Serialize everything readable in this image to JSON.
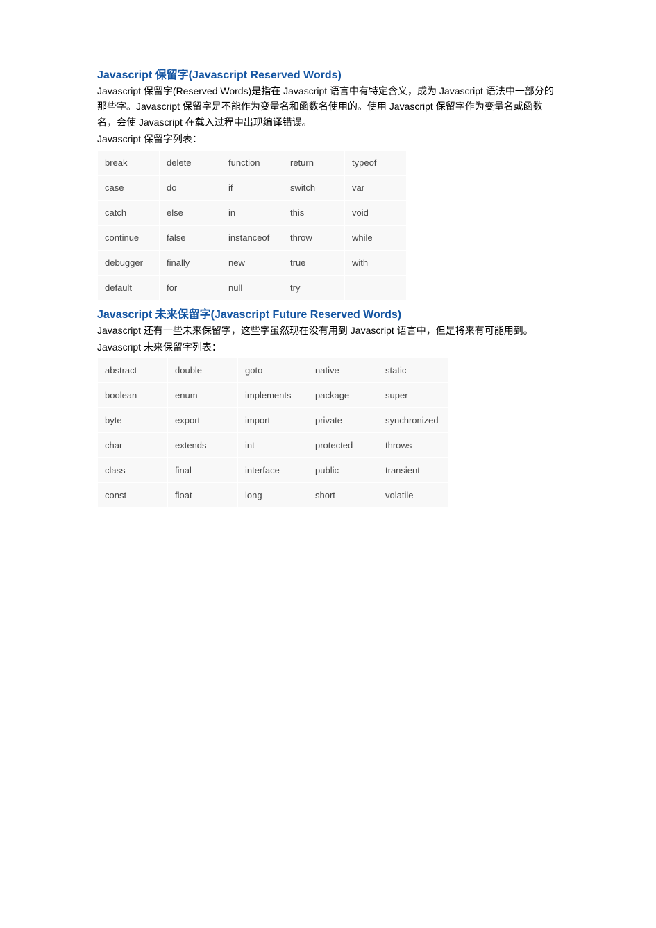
{
  "section1": {
    "heading": "Javascript 保留字(Javascript Reserved Words)",
    "p1": "Javascript 保留字(Reserved  Words)是指在 Javascript 语言中有特定含义，成为 Javascript 语法中一部分的那些字。Javascript 保留字是不能作为变量名和函数名使用的。使用 Javascript 保留字作为变量名或函数名，会使 Javascript 在载入过程中出现编译错误。",
    "p2": "Javascript 保留字列表：",
    "table": [
      [
        "break",
        "delete",
        "function",
        "return",
        "typeof"
      ],
      [
        "case",
        "do",
        "if",
        "switch",
        "var"
      ],
      [
        "catch",
        "else",
        "in",
        "this",
        "void"
      ],
      [
        "continue",
        "false",
        "instanceof",
        "throw",
        "while"
      ],
      [
        "debugger",
        "finally",
        "new",
        "true",
        "with"
      ],
      [
        "default",
        "for",
        "null",
        "try",
        ""
      ]
    ]
  },
  "section2": {
    "heading": "Javascript 未来保留字(Javascript Future Reserved Words)",
    "p1": "Javascript 还有一些未来保留字，这些字虽然现在没有用到 Javascript 语言中，但是将来有可能用到。",
    "p2": "Javascript 未来保留字列表：",
    "table": [
      [
        "abstract",
        "double",
        "goto",
        "native",
        "static"
      ],
      [
        "boolean",
        "enum",
        "implements",
        "package",
        "super"
      ],
      [
        "byte",
        "export",
        "import",
        "private",
        "synchronized"
      ],
      [
        "char",
        "extends",
        "int",
        "protected",
        "throws"
      ],
      [
        "class",
        "final",
        "interface",
        "public",
        "transient"
      ],
      [
        "const",
        "float",
        "long",
        "short",
        "volatile"
      ]
    ]
  }
}
